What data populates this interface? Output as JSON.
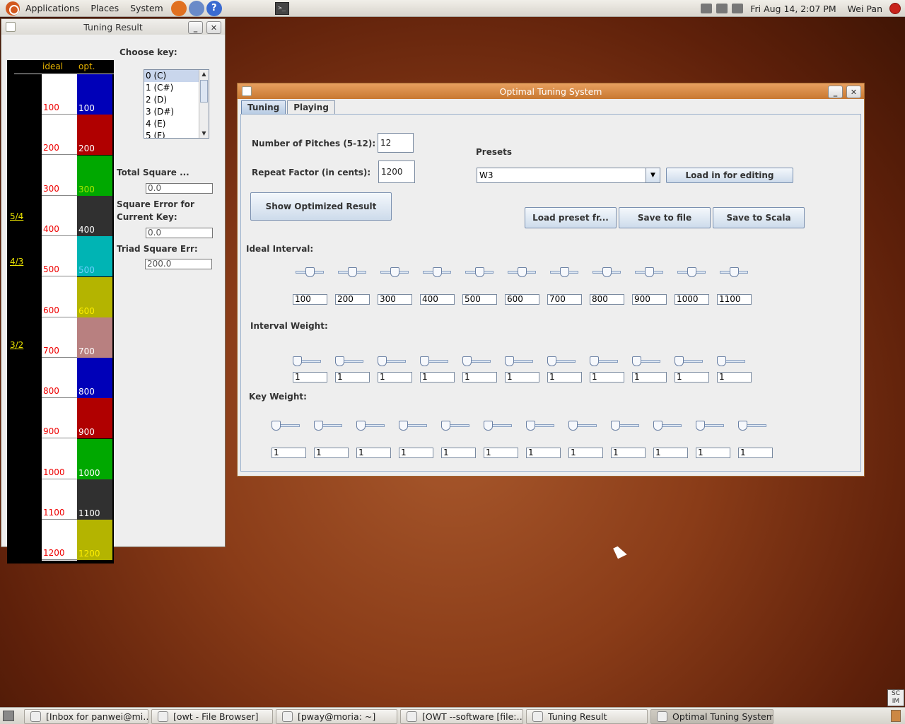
{
  "topbar": {
    "menus": [
      "Applications",
      "Places",
      "System"
    ],
    "clock": "Fri Aug 14,  2:07 PM",
    "user": "Wei Pan"
  },
  "tuning_result": {
    "title": "Tuning Result",
    "header_ideal": "ideal",
    "header_opt": "opt.",
    "ideal_values": [
      "100",
      "200",
      "300",
      "400",
      "500",
      "600",
      "700",
      "800",
      "900",
      "1000",
      "1100",
      "1200"
    ],
    "opt_values": [
      "100",
      "200",
      "300",
      "400",
      "500",
      "600",
      "700",
      "800",
      "900",
      "1000",
      "1100",
      "1200"
    ],
    "opt_colors": [
      "#0000b8",
      "#b00000",
      "#00a800",
      "#303030",
      "#00b4b4",
      "#b4b400",
      "#b88080",
      "#0000b8",
      "#b00000",
      "#00a800",
      "#303030",
      "#b4b400"
    ],
    "opt_text_colors": [
      "#ffffff",
      "#ffffff",
      "#a8e800",
      "#ffffff",
      "#6fd0ff",
      "#ffee00",
      "#ffffff",
      "#ffffff",
      "#ffffff",
      "#ffffff",
      "#ffffff",
      "#ffee00"
    ],
    "ratios": [
      "5/4",
      "4/3",
      "3/2"
    ],
    "choose_key_label": "Choose key:",
    "keys": [
      "0  (C)",
      "1  (C#)",
      "2  (D)",
      "3  (D#)",
      "4  (E)",
      "5  (F)"
    ],
    "total_square_label": "Total Square ...",
    "total_square_value": "0.0",
    "square_error_label_1": "Square Error for",
    "square_error_label_2": "Current Key:",
    "square_error_value": "0.0",
    "triad_label": "Triad Square Err:",
    "triad_value": "200.0"
  },
  "ots": {
    "title": "Optimal Tuning System",
    "tabs": [
      "Tuning",
      "Playing"
    ],
    "pitches_label": "Number of Pitches (5-12):",
    "pitches_value": "12",
    "repeat_label": "Repeat Factor (in cents):",
    "repeat_value": "1200",
    "show_button": "Show Optimized Result",
    "presets_label": "Presets",
    "preset_selected": "W3",
    "load_editing_button": "Load in for editing",
    "load_preset_button": "Load preset fr...",
    "save_file_button": "Save to file",
    "save_scala_button": "Save to Scala",
    "ideal_interval_label": "Ideal Interval:",
    "ideal_interval_values": [
      "100",
      "200",
      "300",
      "400",
      "500",
      "600",
      "700",
      "800",
      "900",
      "1000",
      "1100"
    ],
    "ideal_interval_levels": [
      0.5,
      0.5,
      0.5,
      0.5,
      0.5,
      0.5,
      0.5,
      0.5,
      0.5,
      0.5,
      0.5
    ],
    "interval_weight_label": "Interval Weight:",
    "interval_weight_values": [
      "1",
      "1",
      "1",
      "1",
      "1",
      "1",
      "1",
      "1",
      "1",
      "1",
      "1"
    ],
    "key_weight_label": "Key Weight:",
    "key_weight_values": [
      "1",
      "1",
      "1",
      "1",
      "1",
      "1",
      "1",
      "1",
      "1",
      "1",
      "1",
      "1"
    ]
  },
  "taskbar": {
    "tasks": [
      "[Inbox for panwei@mi…",
      "[owt - File Browser]",
      "[pway@moria: ~]",
      "[OWT --software [file:…",
      "Tuning Result",
      "Optimal Tuning System"
    ]
  },
  "scim_label": "SC IM"
}
